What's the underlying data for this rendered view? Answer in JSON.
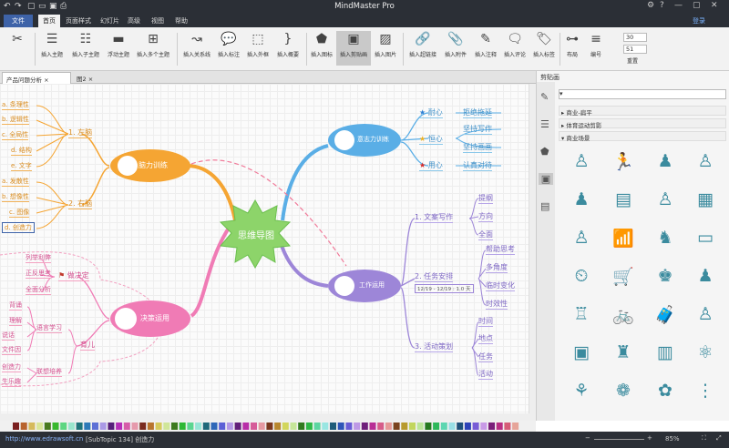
{
  "app": {
    "title": "MindMaster Pro"
  },
  "menu": {
    "file": "文件",
    "items": [
      "首页",
      "页面样式",
      "幻灯片",
      "高级",
      "视图",
      "帮助"
    ],
    "login": "登录"
  },
  "ribbon": {
    "buttons": [
      "插入主题",
      "插入子主题",
      "浮动主题",
      "插入多个主题",
      "插入关系线",
      "插入标注",
      "插入外框",
      "插入概要",
      "插入图标",
      "插入剪贴画",
      "插入图片",
      "插入超链接",
      "插入附件",
      "插入注释",
      "插入评论",
      "插入标签",
      "布局",
      "编号"
    ],
    "spin1": "30",
    "spin2": "51",
    "reset": "重置"
  },
  "tabs": [
    "产品问题分析",
    "图2"
  ],
  "panel": {
    "title": "剪贴画",
    "categories": [
      "商业-扁平",
      "体育运动剪影",
      "商业场景"
    ]
  },
  "map": {
    "center": "思维导图",
    "brain": {
      "label": "脑力训练",
      "left": "1. 左脑",
      "right": "2. 右脑",
      "left_items": [
        "a. 条理性",
        "b. 逻辑性",
        "c. 全局性",
        "d. 结构",
        "e. 文字"
      ],
      "right_items": [
        "a. 发散性",
        "b. 想像性",
        "c. 图像",
        "d. 创造力"
      ]
    },
    "will": {
      "label": "意志力训练",
      "items": [
        "耐心",
        "恒心",
        "用心"
      ],
      "subs": [
        "拒绝拖延",
        "坚持写作",
        "坚持画画",
        "认真对待"
      ]
    },
    "decision": {
      "label": "决策运用",
      "g1": "做决定",
      "g1_items": [
        "列举利弊",
        "正反思考",
        "全面分析"
      ],
      "g2": "育儿",
      "g2a": "语言学习",
      "g2a_items": [
        "背诵",
        "理解",
        "说话",
        "文件因"
      ],
      "g2b": "联想培养",
      "g2b_items": [
        "创造力",
        "生乐趣"
      ]
    },
    "work": {
      "label": "工作运用",
      "b1": "1. 文案写作",
      "b1_items": [
        "提纲",
        "方向",
        "全面"
      ],
      "b2": "2. 任务安排",
      "b2_date": "12/19 - 12/19 : 1.0 天",
      "b2_items": [
        "帮助思考",
        "多角度",
        "临时变化",
        "时效性"
      ],
      "b3": "3. 活动策划",
      "b3_items": [
        "时间",
        "地点",
        "任务",
        "活动"
      ]
    }
  },
  "colors": {
    "orange": "#f5a533",
    "green": "#8dd46a",
    "blue": "#5aaee6",
    "purple": "#9d86d8",
    "pink": "#f07bb5"
  },
  "status": {
    "url": "http://www.edrawsoft.cn",
    "info": "[SubTopic 134]  创造力",
    "zoom": "85%"
  }
}
